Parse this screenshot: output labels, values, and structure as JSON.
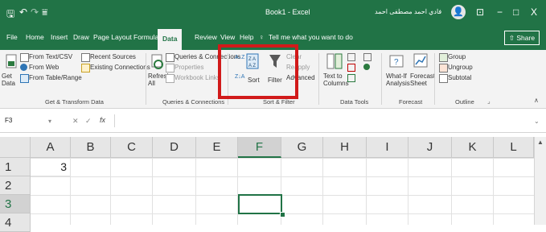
{
  "titlebar": {
    "save_icon": "save-icon",
    "undo_icon": "undo-icon",
    "redo_icon": "redo-icon",
    "customize_icon": "customize-qat-icon",
    "title": "Book1 - Excel",
    "user_name": "فادي احمد مصطفى احمد",
    "avatar_icon": "user-avatar-icon",
    "minimize": "−",
    "maximize": "□",
    "close": "X",
    "ribbon_display": "⊡"
  },
  "tabs": [
    "File",
    "Home",
    "Insert",
    "Draw",
    "Page Layout",
    "Formulas",
    "Data",
    "Review",
    "View",
    "Help"
  ],
  "active_tab": "Data",
  "tell_me": "Tell me what you want to do",
  "share": "Share",
  "ribbon": {
    "get_data": "Get Data",
    "from_text": "From Text/CSV",
    "from_web": "From Web",
    "from_table": "From Table/Range",
    "recent_sources": "Recent Sources",
    "existing_connections": "Existing Connections",
    "group_get": "Get & Transform Data",
    "refresh_all": "Refresh All",
    "queries": "Queries & Connections",
    "properties": "Properties",
    "workbook_links": "Workbook Links",
    "group_queries": "Queries & Connections",
    "sort_az": "A↓Z",
    "sort_za": "Z↓A",
    "sort": "Sort",
    "filter": "Filter",
    "clear": "Clear",
    "reapply": "Reapply",
    "advanced": "Advanced",
    "group_sort": "Sort & Filter",
    "text_to_columns": "Text to Columns",
    "group_data_tools": "Data Tools",
    "what_if": "What-If Analysis",
    "forecast_sheet": "Forecast Sheet",
    "group_forecast": "Forecast",
    "group": "Group",
    "ungroup": "Ungroup",
    "subtotal": "Subtotal",
    "group_outline": "Outline"
  },
  "formula_bar": {
    "name_box": "F3",
    "cancel": "✕",
    "enter": "✓",
    "fx": "fx",
    "value": ""
  },
  "grid": {
    "columns": [
      "A",
      "B",
      "C",
      "D",
      "E",
      "F",
      "G",
      "H",
      "I",
      "J",
      "K",
      "L"
    ],
    "selected_column": "F",
    "rows": [
      "1",
      "2",
      "3",
      "4"
    ],
    "selected_row": "3",
    "cells": {
      "A1": "3"
    }
  }
}
